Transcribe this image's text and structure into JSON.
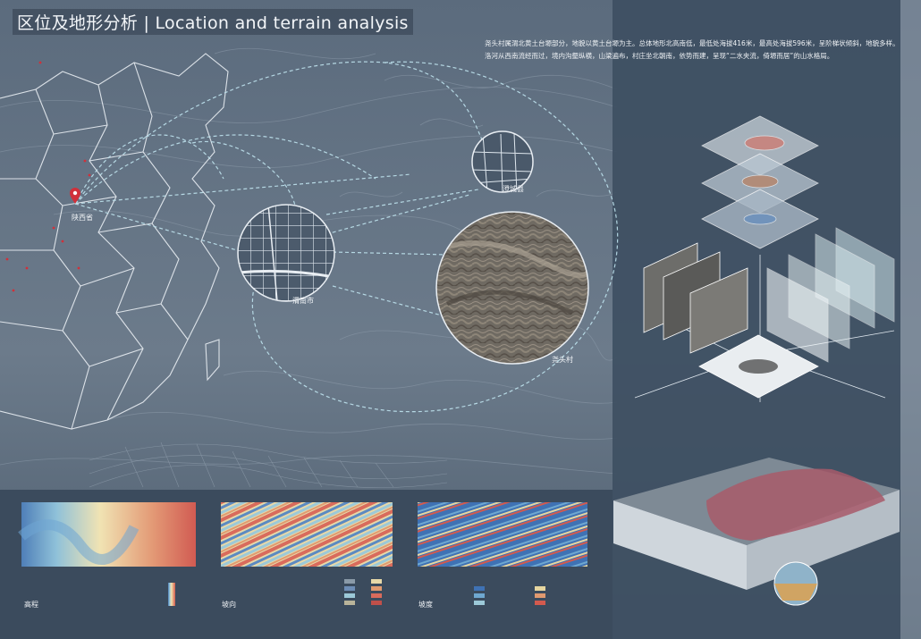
{
  "title": "区位及地形分析 | Location and terrain analysis",
  "description": "尧头村属渭北黄土台塬部分，地貌以黄土台塬为主。总体地形北高南低，最低处海拔416米，最高处海拔596米，呈阶梯状倾斜，地貌多样。洛河从西南流经而过，境内沟壑纵横，山梁遍布，村庄坐北朝南，依势而建，呈现“二水夹流，倚塬而居”的山水格局。",
  "places": {
    "province": "陕西省",
    "city": "渭南市",
    "county": "澄城县",
    "village": "尧头村"
  },
  "analysis": {
    "elevation": "高程",
    "aspect": "坡向",
    "slope": "坡度"
  },
  "colors": {
    "background": "#4a5a6c",
    "panel": "#3e4f62",
    "accent_line": "#bfe3ee",
    "pin": "#d0303a"
  }
}
